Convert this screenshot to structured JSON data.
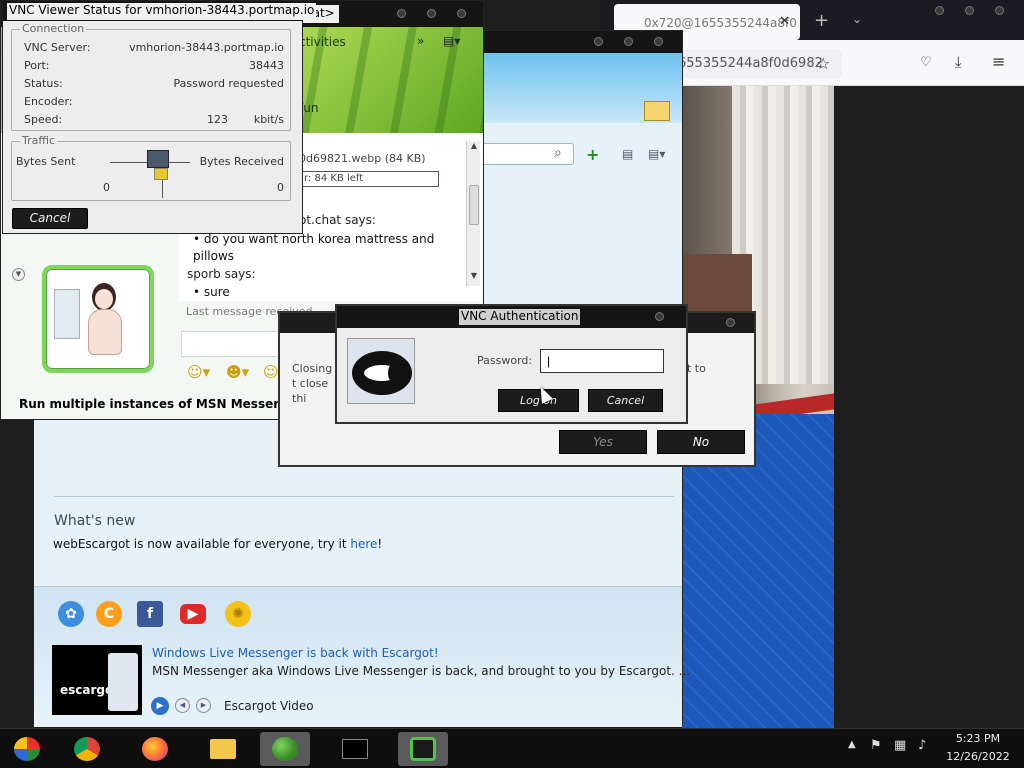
{
  "browser": {
    "tab_title": "0x720@1655355244a8f0",
    "tab_close": "✕",
    "new_tab": "+",
    "tabs_menu": "⌄",
    "url": "655355244a8f0d6982"
  },
  "vnc_status": {
    "title": "VNC Viewer Status for vmhorion-38443.portmap.io",
    "connection_title": "Connection",
    "rows": [
      {
        "label": "VNC Server:",
        "value": "vmhorion-38443.portmap.io"
      },
      {
        "label": "Port:",
        "value": "38443"
      },
      {
        "label": "Status:",
        "value": "Password requested"
      },
      {
        "label": "Encoder:",
        "value": ""
      },
      {
        "label": "Speed:",
        "value": "123"
      }
    ],
    "speed_unit": "kbit/s",
    "traffic_title": "Traffic",
    "bytes_sent_label": "Bytes Sent",
    "bytes_received_label": "Bytes Received",
    "bytes_sent": "0",
    "bytes_received": "0",
    "cancel": "Cancel"
  },
  "chat": {
    "title_tab": "hat>",
    "activities": "ctivities",
    "fun": "fun",
    "file_name": "0d69821.webp (84 KB)",
    "file_progress": "r: 84 KB left",
    "says_1": "ot.chat says:",
    "message_1": "do you want north korea mattress and pillows",
    "says_2": "sporb says:",
    "message_2": "sure",
    "last_message": "Last message received",
    "footer": "Run multiple instances of MSN Messenger wi"
  },
  "msn": {
    "whats_new_title": "What's new",
    "whats_new_text": "webEscargot is now available for everyone, try it ",
    "whats_new_link": "here",
    "whats_new_after": "!",
    "news_title": "Windows Live Messenger is back with Escargot!",
    "news_desc": "MSN Messenger aka Windows Live Messenger is back, and brought to you by Escargot. ...",
    "video_label": "Escargot Video",
    "thumb_label": "escargot"
  },
  "close_dialog": {
    "text_left": "Closing t close thi",
    "text_right": "nt to",
    "yes": "Yes",
    "no": "No"
  },
  "auth": {
    "title": "VNC Authentication",
    "password_label": "Password:",
    "password_value": "|",
    "login": "Log on",
    "cancel": "Cancel"
  },
  "taskbar": {
    "time": "5:23 PM",
    "date": "12/26/2022",
    "tray_arrow": "▲"
  },
  "colors": {
    "accent_green": "#7ed65a",
    "link_blue": "#1a5fb4",
    "taskbar": "#0e0e0e"
  }
}
